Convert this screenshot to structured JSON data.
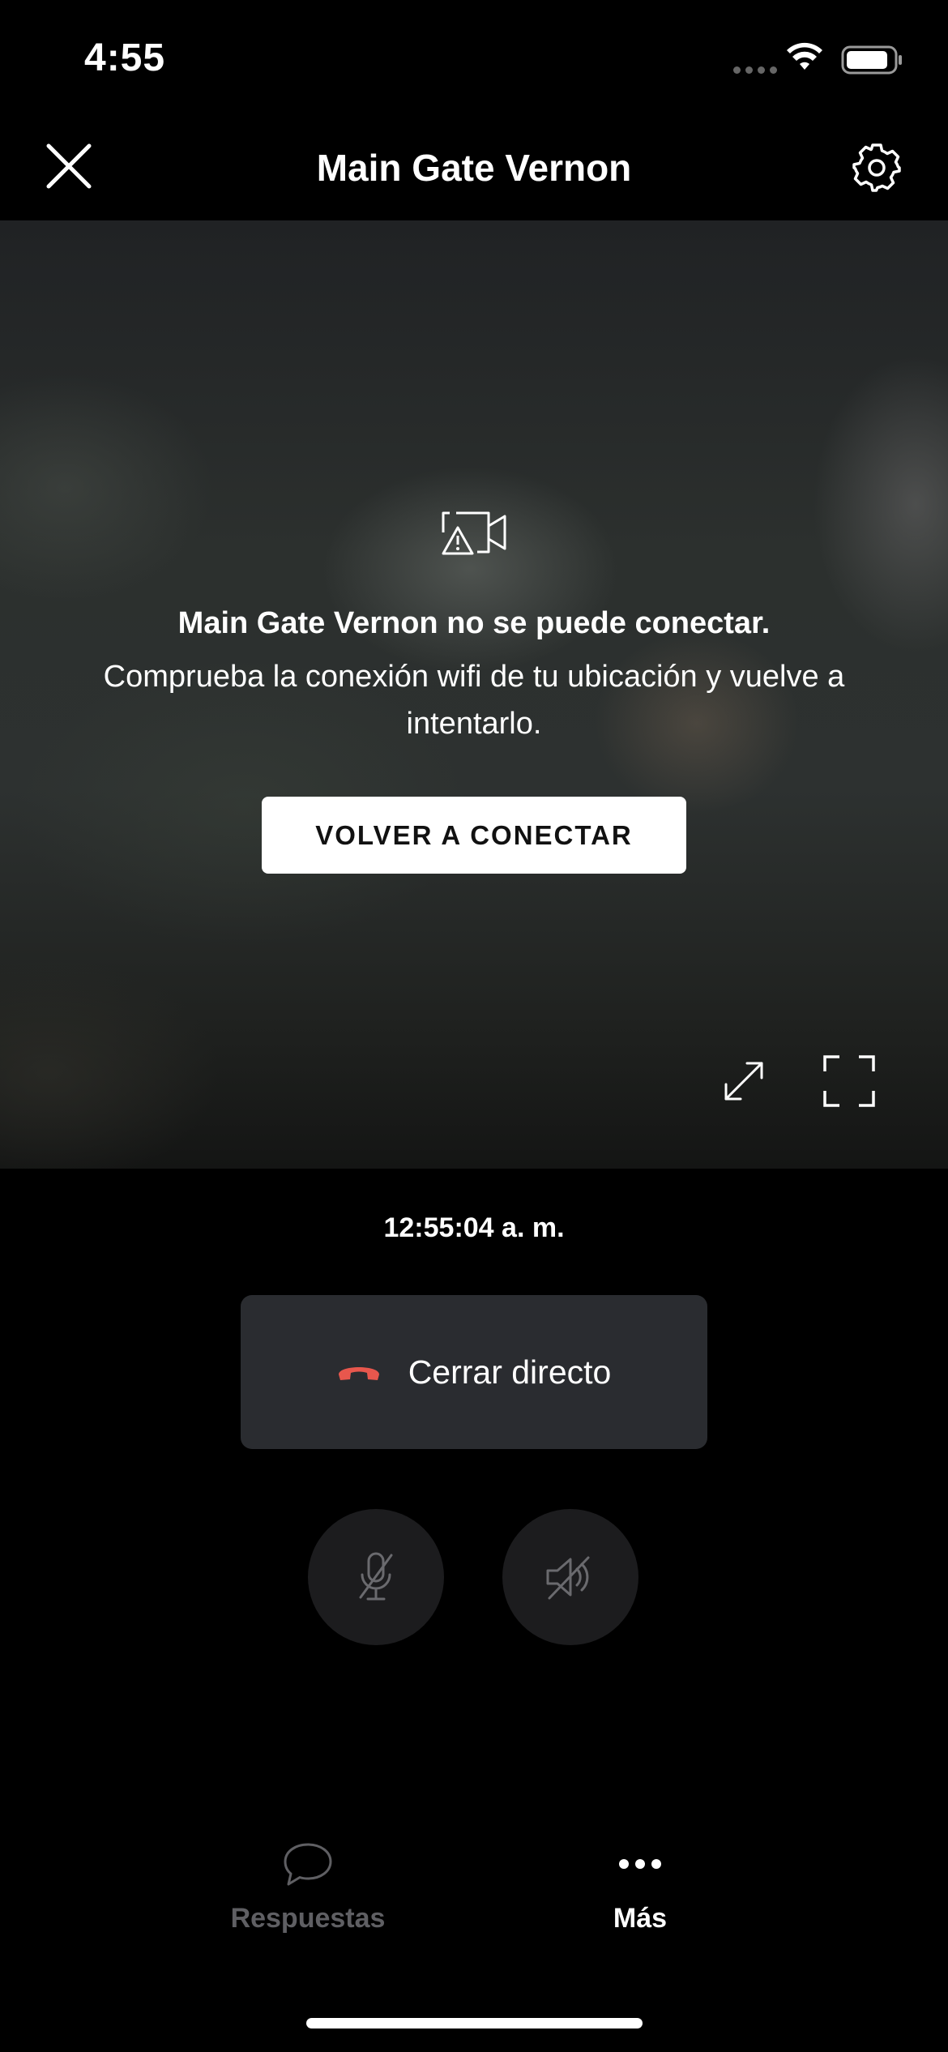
{
  "status_bar": {
    "time": "4:55"
  },
  "header": {
    "title": "Main Gate Vernon",
    "close_icon": "close-icon",
    "settings_icon": "gear-icon"
  },
  "video": {
    "status_icon": "video-off-warning-icon",
    "error_title": "Main Gate Vernon no se puede conectar.",
    "error_message": "Comprueba la conexión wifi de tu ubicación y vuelve a intentarlo.",
    "reconnect_label": "VOLVER A CONECTAR",
    "expand_icon": "expand-arrows-icon",
    "fullscreen_icon": "fullscreen-icon"
  },
  "controls": {
    "timestamp": "12:55:04 a. m.",
    "end_live_label": "Cerrar directo",
    "end_live_color": "#e8574d",
    "mic_icon": "mic-off-icon",
    "speaker_icon": "speaker-off-icon"
  },
  "tab_bar": {
    "tabs": [
      {
        "label": "Respuestas",
        "icon": "chat-bubble-icon",
        "active": false
      },
      {
        "label": "Más",
        "icon": "more-dots-icon",
        "active": true
      }
    ]
  },
  "colors": {
    "background": "#000000",
    "button_bg": "#2a2c30",
    "round_button_bg": "#1c1c1e",
    "inactive_tab": "#5f5f63"
  }
}
